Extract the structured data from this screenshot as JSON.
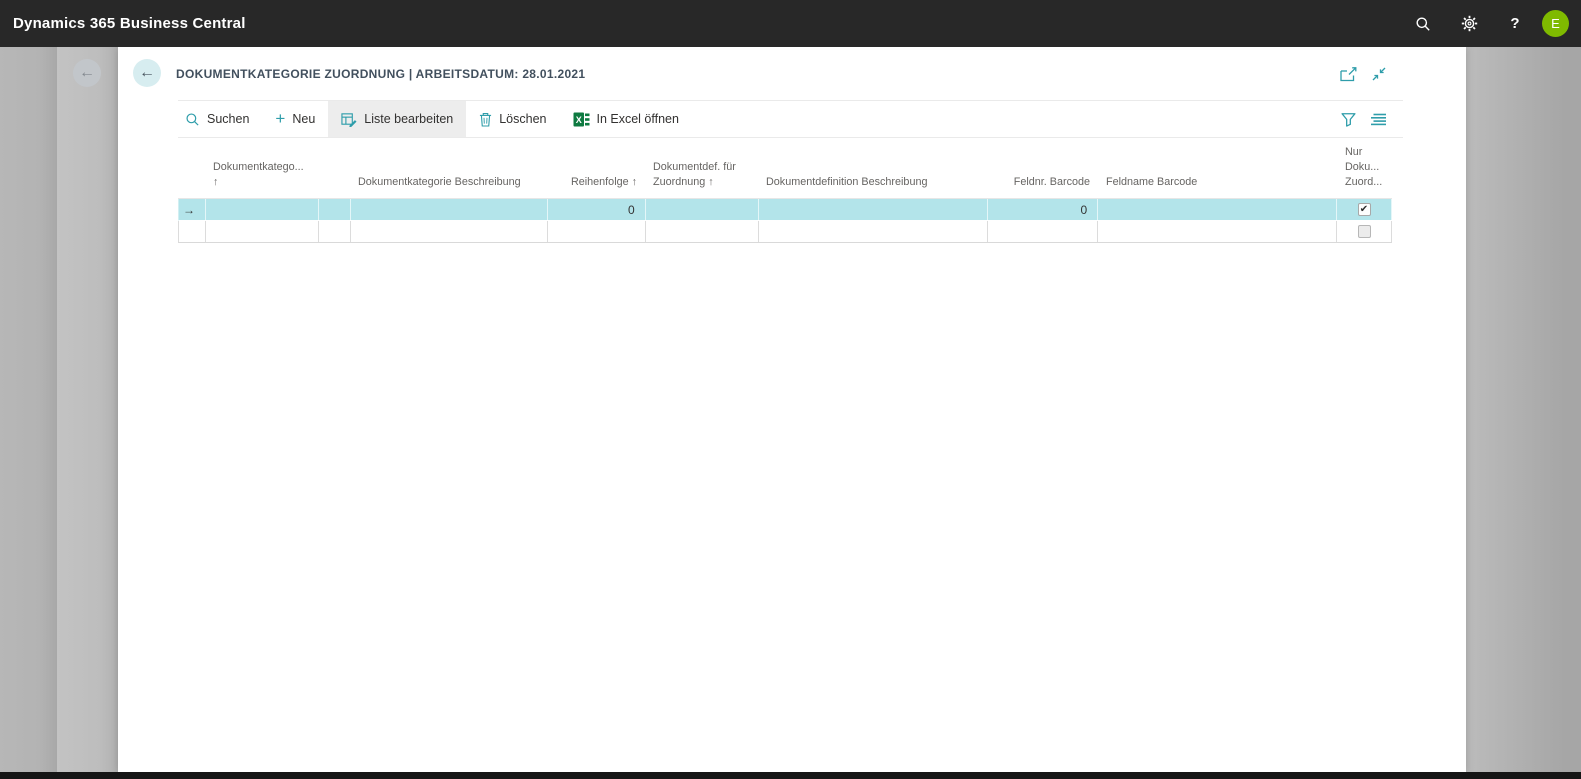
{
  "topbar": {
    "title": "Dynamics 365 Business Central",
    "help_label": "?",
    "avatar_initial": "E"
  },
  "page": {
    "back_arrow": "←",
    "title": "DOKUMENTKATEGORIE ZUORDNUNG | ARBEITSDATUM: 28.01.2021"
  },
  "toolbar": {
    "search_label": "Suchen",
    "new_plus": "+",
    "new_label": "Neu",
    "edit_list_label": "Liste bearbeiten",
    "delete_label": "Löschen",
    "excel_label": "In Excel öffnen"
  },
  "table": {
    "headers": {
      "dokumentkategorie": "Dokumentkatego...\n↑",
      "dokumentkategorie_beschreibung": "Dokumentkategorie Beschreibung",
      "reihenfolge": "Reihenfolge ↑",
      "dokumentdef_fuer_zuordnung": "Dokumentdef. für\nZuordnung ↑",
      "dokumentdefinition_beschreibung": "Dokumentdefinition Beschreibung",
      "feldnr_barcode": "Feldnr. Barcode",
      "feldname_barcode": "Feldname Barcode",
      "nur_doku_zuord": "Nur\nDoku...\nZuord..."
    },
    "rows": [
      {
        "indicator": "→",
        "dokumentkategorie": "",
        "dokumentkategorie_beschreibung": "",
        "reihenfolge": "0",
        "dokumentdef_fuer_zuordnung": "",
        "dokumentdefinition_beschreibung": "",
        "feldnr_barcode": "0",
        "feldname_barcode": "",
        "check": "✔"
      },
      {
        "indicator": "",
        "dokumentkategorie": "",
        "dokumentkategorie_beschreibung": "",
        "reihenfolge": "",
        "dokumentdef_fuer_zuordnung": "",
        "dokumentdefinition_beschreibung": "",
        "feldnr_barcode": "",
        "feldname_barcode": "",
        "check": ""
      }
    ]
  },
  "colors": {
    "topbar_bg": "#282828",
    "accent_teal": "#2e9daa",
    "avatar_green": "#7fba00",
    "selected_row": "#b3e4ea",
    "excel_green": "#0e7a41"
  }
}
